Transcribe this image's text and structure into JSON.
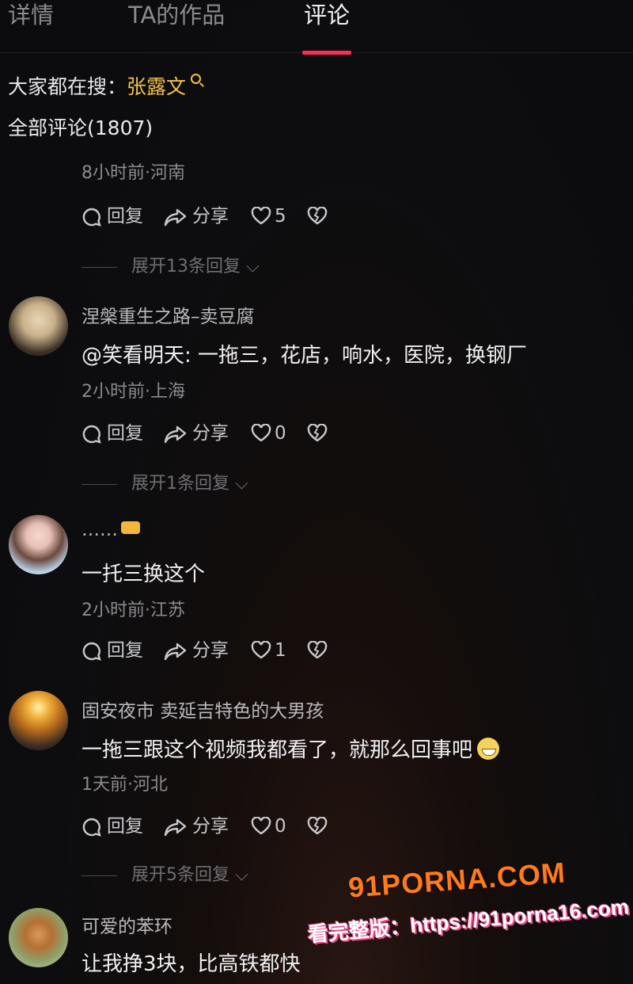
{
  "tabs": [
    {
      "label": "详情",
      "active": false
    },
    {
      "label": "TA的作品",
      "active": false
    },
    {
      "label": "评论",
      "active": true
    }
  ],
  "hot_search": {
    "prefix": "大家都在搜：",
    "keyword": "张露文"
  },
  "total_label": "全部评论(1807)",
  "actions": {
    "reply": "回复",
    "share": "分享"
  },
  "comments": [
    {
      "user": "",
      "text": "",
      "meta": "8小时前·河南",
      "likes": "5",
      "expand": "展开13条回复"
    },
    {
      "user": "涅槃重生之路–卖豆腐",
      "text": "@笑看明天: 一拖三，花店，响水，医院，换钢厂",
      "meta": "2小时前·上海",
      "likes": "0",
      "expand": "展开1条回复"
    },
    {
      "user": "……",
      "text": "一托三换这个",
      "meta": "2小时前·江苏",
      "likes": "1",
      "expand": ""
    },
    {
      "user": "固安夜市 卖延吉特色的大男孩",
      "text": "一拖三跟这个视频我都看了，就那么回事吧",
      "meta": "1天前·河北",
      "likes": "0",
      "expand": "展开5条回复"
    },
    {
      "user": "可爱的苯环",
      "text": "让我挣3块，比高铁都快",
      "meta": "",
      "likes": "",
      "expand": ""
    }
  ],
  "watermark": {
    "logo": "91PORNA.COM",
    "url": "看完整版：https://91porna16.com"
  },
  "colors": {
    "accent": "#ff2c55",
    "keyword": "#f3c24b",
    "background": "#0e0e10"
  }
}
